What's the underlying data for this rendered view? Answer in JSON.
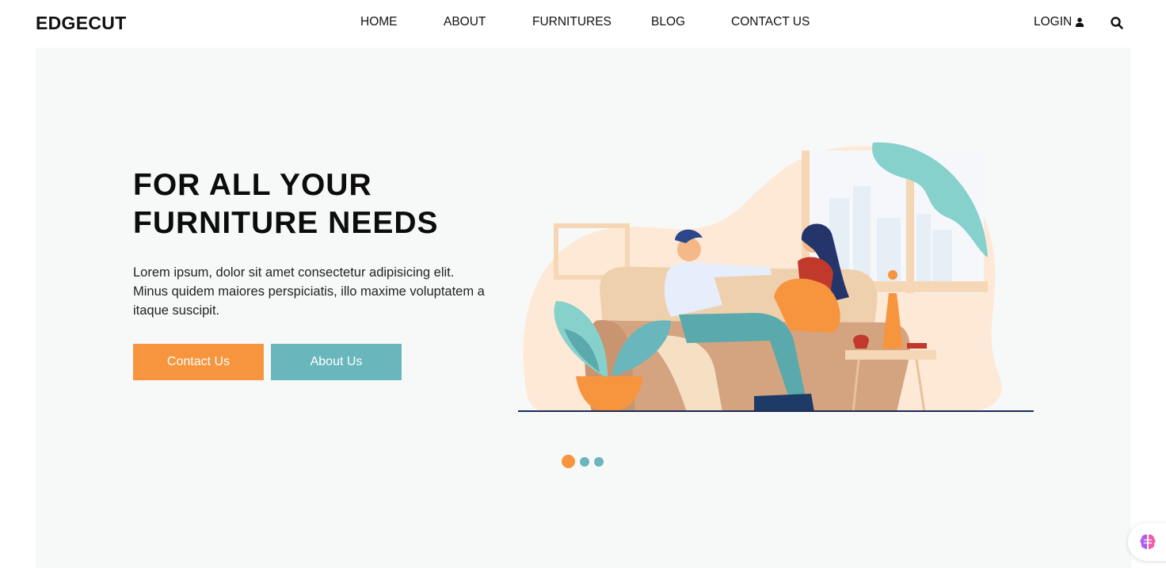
{
  "header": {
    "brand": "EDGECUT",
    "nav": [
      {
        "label": "HOME"
      },
      {
        "label": "ABOUT"
      },
      {
        "label": "FURNITURES"
      },
      {
        "label": "BLOG"
      },
      {
        "label": "CONTACT US"
      }
    ],
    "login_label": "LOGIN",
    "icons": {
      "login": "user-icon",
      "search": "search-icon"
    }
  },
  "hero": {
    "headline_line1": "FOR ALL YOUR",
    "headline_line2": "FURNITURE NEEDS",
    "description": "Lorem ipsum, dolor sit amet consectetur adipisicing elit. Minus quidem maiores perspiciatis, illo maxime voluptatem a itaque suscipit.",
    "contact_button": "Contact Us",
    "about_button": "About Us",
    "illustration": "couple-sitting-on-sofa-illustration"
  },
  "carousel": {
    "slides": 3,
    "active_index": 0
  },
  "colors": {
    "accent_orange": "#f7953f",
    "accent_teal": "#6ab6bd",
    "hero_background": "#f7f9f9"
  }
}
